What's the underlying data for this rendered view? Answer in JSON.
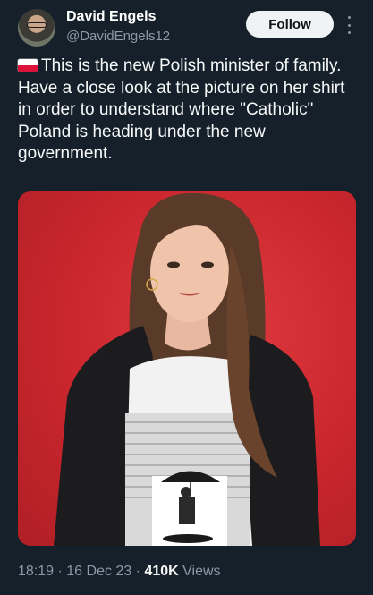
{
  "author": {
    "display_name": "David Engels",
    "handle": "@DavidEngels12",
    "avatar_icon": "user-avatar"
  },
  "actions": {
    "follow_label": "Follow",
    "more_icon": "more-vertical-icon"
  },
  "tweet": {
    "flag_icon": "poland-flag-emoji",
    "text": "This is the new Polish minister of family. Have a close look at the picture on her shirt in order to understand where \"Catholic\" Poland is heading under the new government."
  },
  "media": {
    "background_color": "#c9262d",
    "description_icon": "photo"
  },
  "meta": {
    "time": "18:19",
    "separator": "·",
    "date": "16 Dec 23",
    "views_count": "410K",
    "views_label": "Views"
  },
  "colors": {
    "background": "#15202b",
    "text": "#f7f9f9",
    "secondary_text": "#8b98a5",
    "follow_bg": "#eff3f4"
  }
}
